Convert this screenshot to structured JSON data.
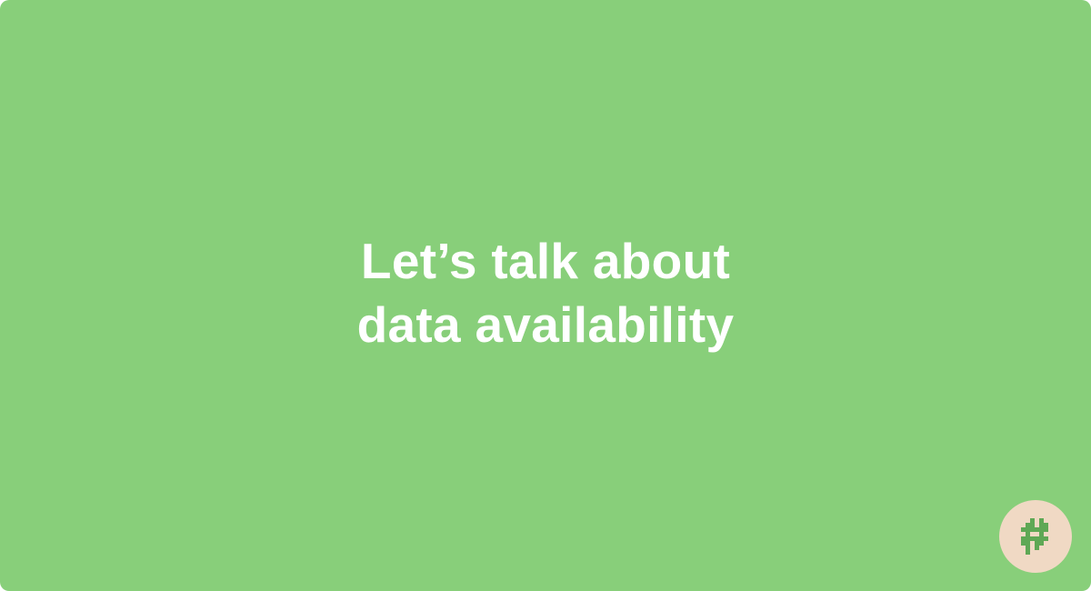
{
  "colors": {
    "background": "#88cf7a",
    "text": "#ffffff",
    "badge_background": "#f0d9c4",
    "badge_icon": "#5fa855"
  },
  "headline": {
    "line1": "Let’s talk about",
    "line2": "data availability"
  },
  "badge": {
    "icon": "pixel-hash-logo-icon"
  }
}
